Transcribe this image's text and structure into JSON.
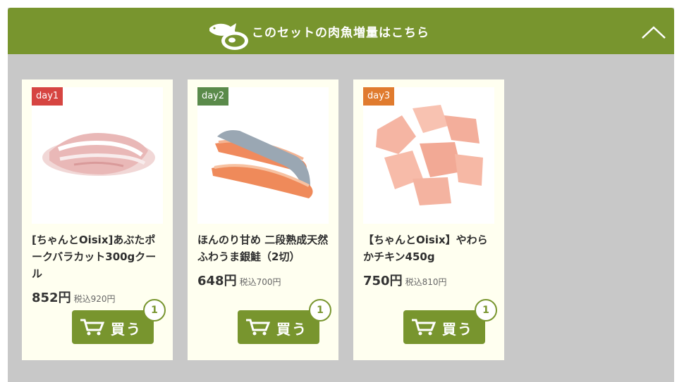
{
  "header": {
    "title": "このセットの肉魚増量はこちら",
    "color": "#78952e"
  },
  "products": [
    {
      "day": "day1",
      "day_color": "#d64541",
      "name": "[ちゃんとOisix]あぶたポークバラカット300gクール",
      "price": "852円",
      "tax": "税込920円",
      "buy": "買う",
      "qty": "1"
    },
    {
      "day": "day2",
      "day_color": "#5a8a4a",
      "name": "ほんのり甘め 二段熟成天然ふわうま銀鮭（2切）",
      "price": "648円",
      "tax": "税込700円",
      "buy": "買う",
      "qty": "1"
    },
    {
      "day": "day3",
      "day_color": "#e07b2e",
      "name": "【ちゃんとOisix】やわらかチキン450g",
      "price": "750円",
      "tax": "税込810円",
      "buy": "買う",
      "qty": "1"
    }
  ],
  "icons": {
    "header": "fish-meat-icon",
    "collapse": "chevron-up-icon",
    "cart": "cart-icon"
  }
}
